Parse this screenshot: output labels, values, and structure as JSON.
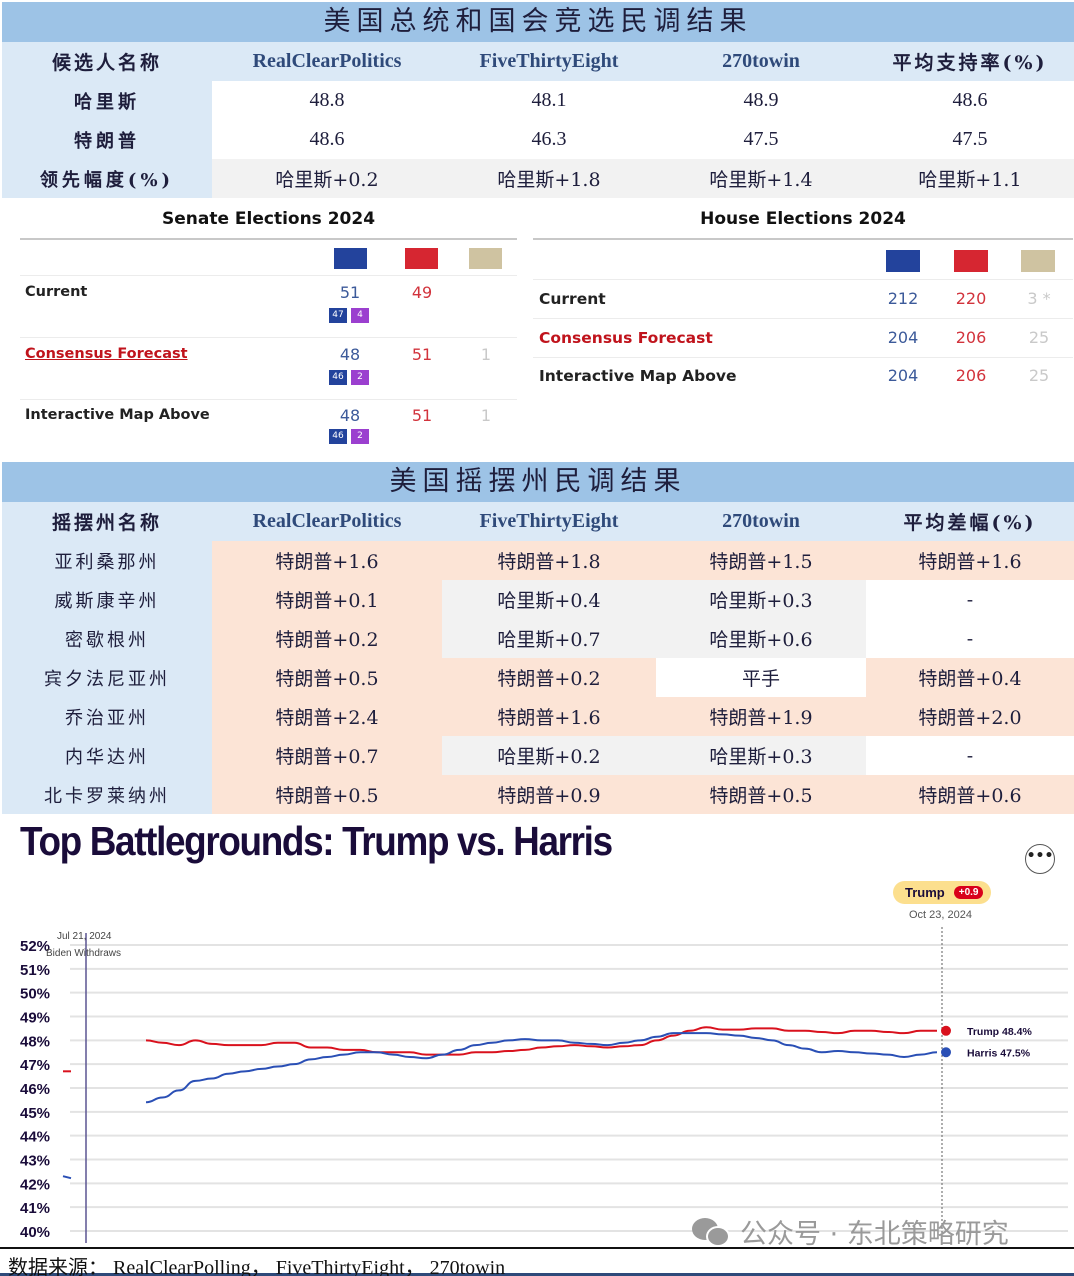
{
  "national": {
    "title": "美国总统和国会竞选民调结果",
    "headers": [
      "候选人名称",
      "RealClearPolitics",
      "FiveThirtyEight",
      "270towin",
      "平均支持率(%)"
    ],
    "rows": [
      {
        "label": "哈里斯",
        "values": [
          "48.8",
          "48.1",
          "48.9",
          "48.6"
        ]
      },
      {
        "label": "特朗普",
        "values": [
          "48.6",
          "46.3",
          "47.5",
          "47.5"
        ]
      },
      {
        "label": "领先幅度(%)",
        "values": [
          "哈里斯+0.2",
          "哈里斯+1.8",
          "哈里斯+1.4",
          "哈里斯+1.1"
        ]
      }
    ]
  },
  "senate": {
    "title": "Senate Elections 2024",
    "legend": {
      "dem": "#23439c",
      "rep": "#d62631",
      "other": "#cfc3a1"
    },
    "rows": [
      {
        "label": "Current",
        "dem": "51",
        "rep": "49",
        "other": "",
        "dem_split": [
          "47",
          "4"
        ]
      },
      {
        "label": "Consensus Forecast",
        "dem": "48",
        "rep": "51",
        "other": "1",
        "dem_split": [
          "46",
          "2"
        ]
      },
      {
        "label": "Interactive Map Above",
        "dem": "48",
        "rep": "51",
        "other": "1",
        "dem_split": [
          "46",
          "2"
        ]
      }
    ]
  },
  "house": {
    "title": "House Elections 2024",
    "rows": [
      {
        "label": "Current",
        "dem": "212",
        "rep": "220",
        "other": "3 *"
      },
      {
        "label": "Consensus Forecast",
        "dem": "204",
        "rep": "206",
        "other": "25"
      },
      {
        "label": "Interactive Map Above",
        "dem": "204",
        "rep": "206",
        "other": "25"
      }
    ]
  },
  "swing": {
    "title": "美国摇摆州民调结果",
    "headers": [
      "摇摆州名称",
      "RealClearPolitics",
      "FiveThirtyEight",
      "270towin",
      "平均差幅(%)"
    ],
    "rows": [
      {
        "state": "亚利桑那州",
        "values": [
          "特朗普+1.6",
          "特朗普+1.8",
          "特朗普+1.5",
          "特朗普+1.6"
        ]
      },
      {
        "state": "威斯康辛州",
        "values": [
          "特朗普+0.1",
          "哈里斯+0.4",
          "哈里斯+0.3",
          "-"
        ]
      },
      {
        "state": "密歇根州",
        "values": [
          "特朗普+0.2",
          "哈里斯+0.7",
          "哈里斯+0.6",
          "-"
        ]
      },
      {
        "state": "宾夕法尼亚州",
        "values": [
          "特朗普+0.5",
          "特朗普+0.2",
          "平手",
          "特朗普+0.4"
        ]
      },
      {
        "state": "乔治亚州",
        "values": [
          "特朗普+2.4",
          "特朗普+1.6",
          "特朗普+1.9",
          "特朗普+2.0"
        ]
      },
      {
        "state": "内华达州",
        "values": [
          "特朗普+0.7",
          "哈里斯+0.2",
          "哈里斯+0.3",
          "-"
        ]
      },
      {
        "state": "北卡罗莱纳州",
        "values": [
          "特朗普+0.5",
          "特朗普+0.9",
          "特朗普+0.5",
          "特朗普+0.6"
        ]
      }
    ]
  },
  "chart_data": {
    "type": "line",
    "title": "Top Battlegrounds: Trump vs. Harris",
    "ylim": [
      40,
      52
    ],
    "yticks": [
      "52%",
      "51%",
      "50%",
      "49%",
      "48%",
      "47%",
      "46%",
      "45%",
      "44%",
      "43%",
      "42%",
      "41%",
      "40%"
    ],
    "grid": true,
    "annotation": {
      "date": "Jul 21, 2024",
      "label": "Biden Withdraws"
    },
    "leader_badge": {
      "candidate": "Trump",
      "lead": "+0.9",
      "date": "Oct 23, 2024"
    },
    "pre_markers": [
      {
        "series": "Trump",
        "value": 46.7
      },
      {
        "series": "Harris",
        "value": 42.3
      }
    ],
    "x_start_label": "Jul 21, 2024",
    "x_end_label": "Oct 23, 2024",
    "series": [
      {
        "name": "Trump",
        "color": "#d9111d",
        "end_label": "Trump 48.4%",
        "values": [
          48.0,
          47.9,
          47.8,
          48.0,
          47.85,
          47.8,
          47.8,
          47.8,
          47.9,
          47.9,
          47.7,
          47.7,
          47.6,
          47.6,
          47.5,
          47.5,
          47.5,
          47.4,
          47.4,
          47.4,
          47.5,
          47.5,
          47.55,
          47.6,
          47.7,
          47.75,
          47.8,
          47.75,
          47.7,
          47.75,
          47.8,
          48.0,
          48.2,
          48.4,
          48.55,
          48.45,
          48.45,
          48.5,
          48.5,
          48.4,
          48.4,
          48.35,
          48.3,
          48.4,
          48.4,
          48.35,
          48.3,
          48.4,
          48.4
        ]
      },
      {
        "name": "Harris",
        "color": "#2a4fb5",
        "end_label": "Harris 47.5%",
        "values": [
          45.4,
          45.6,
          45.9,
          46.3,
          46.4,
          46.6,
          46.7,
          46.8,
          46.9,
          47.0,
          47.2,
          47.3,
          47.4,
          47.5,
          47.5,
          47.4,
          47.3,
          47.25,
          47.4,
          47.6,
          47.8,
          47.9,
          48.0,
          48.05,
          48.0,
          48.0,
          47.9,
          47.85,
          47.8,
          47.9,
          48.0,
          48.15,
          48.3,
          48.3,
          48.3,
          48.25,
          48.2,
          48.1,
          48.0,
          47.8,
          47.65,
          47.5,
          47.55,
          47.5,
          47.45,
          47.4,
          47.3,
          47.4,
          47.5
        ]
      }
    ]
  },
  "watermark": "公众号 · 东北策略研究",
  "source": "数据来源： RealClearPolling， FiveThirtyEight， 270towin",
  "more_button": "•••"
}
